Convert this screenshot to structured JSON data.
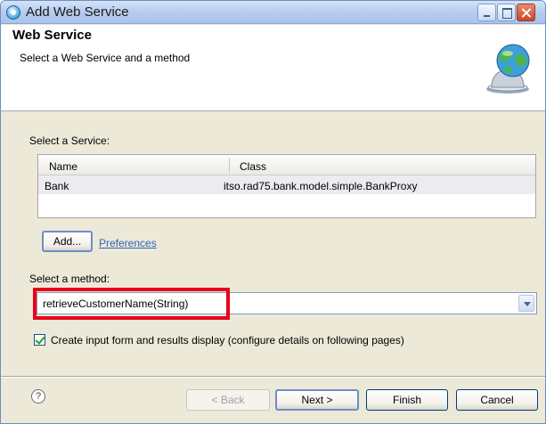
{
  "window": {
    "title": "Add Web Service"
  },
  "banner": {
    "title": "Web Service",
    "subtitle": "Select a Web Service and a method"
  },
  "services": {
    "label": "Select a Service:",
    "columns": [
      "Name",
      "Class"
    ],
    "rows": [
      {
        "name": "Bank",
        "class": "itso.rad75.bank.model.simple.BankProxy"
      }
    ]
  },
  "actions": {
    "add_label": "Add...",
    "preferences_link": "Preferences"
  },
  "method": {
    "label": "Select a method:",
    "value": "retrieveCustomerName(String)"
  },
  "options": {
    "create_form_label": "Create input form and results display (configure details on following pages)",
    "create_form_checked": true
  },
  "footer": {
    "help": "?",
    "back": "< Back",
    "next": "Next >",
    "finish": "Finish",
    "cancel": "Cancel"
  },
  "colors": {
    "highlight": "#e8001c",
    "link": "#2f64b4"
  }
}
